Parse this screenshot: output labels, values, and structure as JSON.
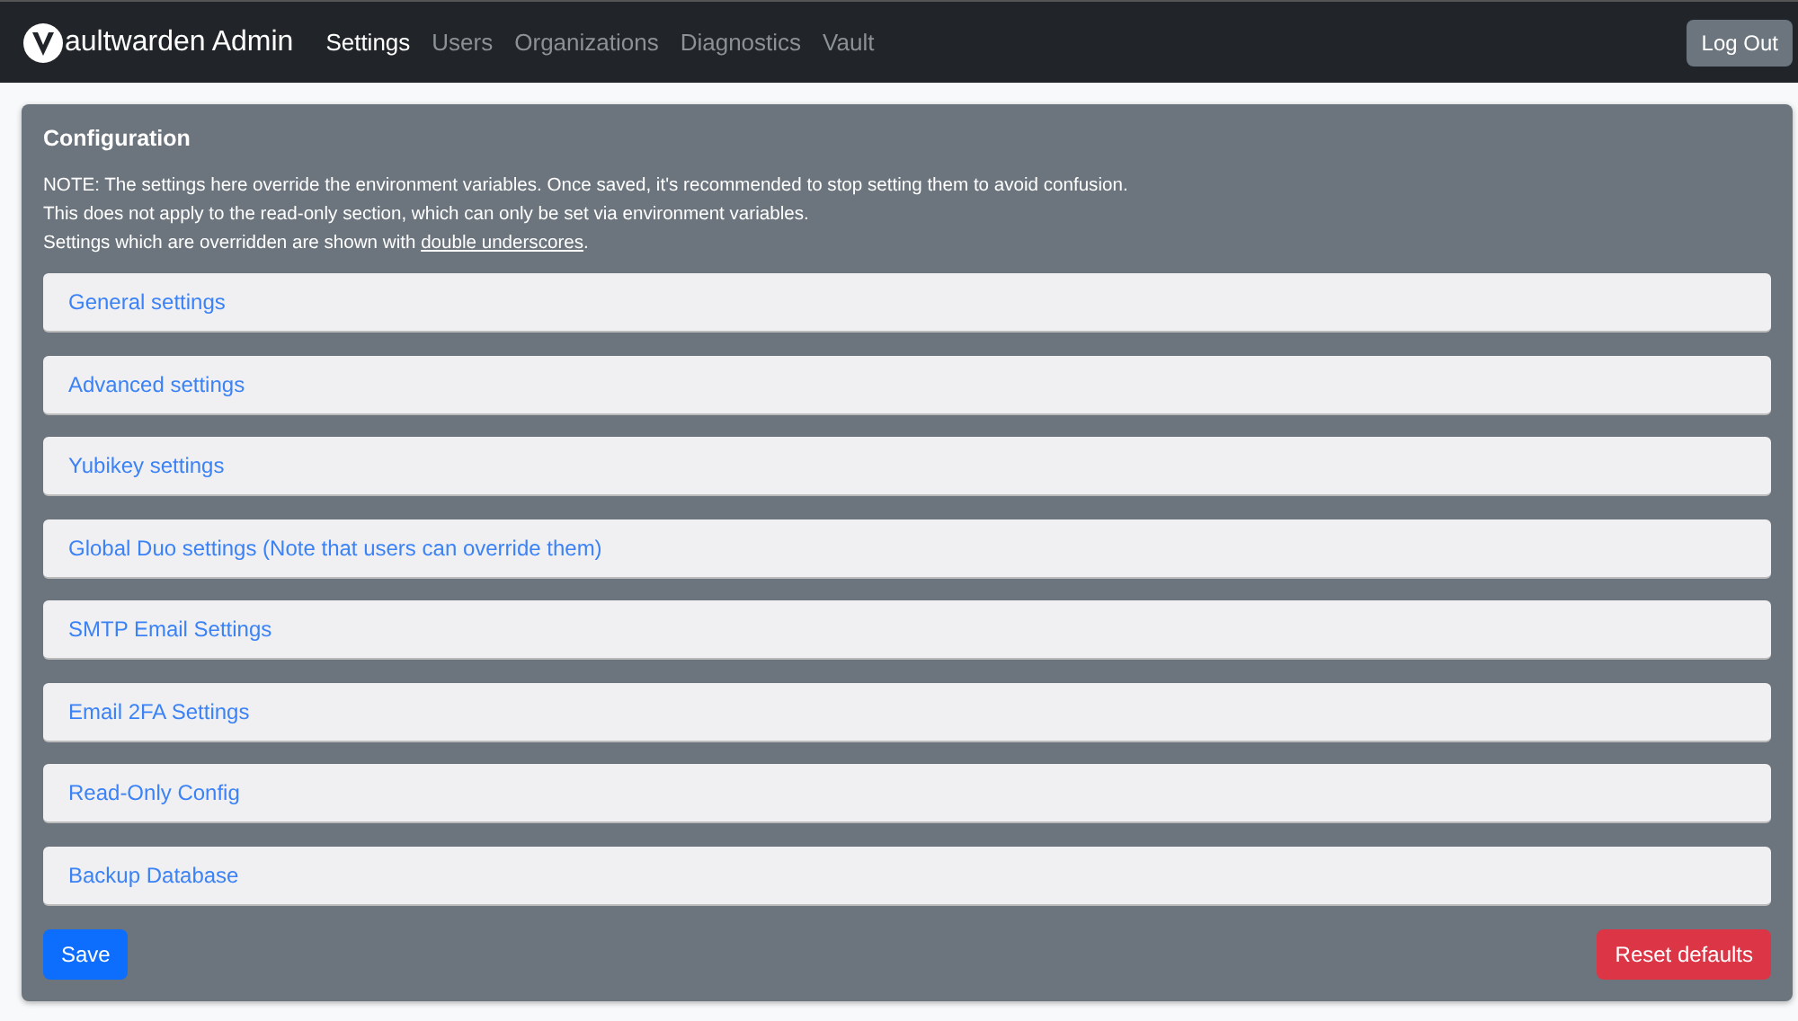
{
  "navbar": {
    "brand": "aultwarden Admin",
    "links": [
      {
        "label": "Settings",
        "selected": true
      },
      {
        "label": "Users",
        "selected": false
      },
      {
        "label": "Organizations",
        "selected": false
      },
      {
        "label": "Diagnostics",
        "selected": false
      },
      {
        "label": "Vault",
        "selected": false
      }
    ],
    "logout": "Log Out"
  },
  "panel": {
    "title": "Configuration",
    "note_lines": [
      "NOTE: The settings here override the environment variables. Once saved, it's recommended to stop setting them to avoid confusion.",
      "This does not apply to the read-only section, which can only be set via environment variables."
    ],
    "legend": {
      "before": "Settings which are overridden are shown with ",
      "underlined": "double underscores",
      "after": "."
    },
    "sections": [
      {
        "label": "General settings",
        "expanded": false
      },
      {
        "label": "Advanced settings",
        "expanded": false
      },
      {
        "label": "Yubikey settings",
        "expanded": false
      },
      {
        "label": "Global Duo settings (Note that users can override them)",
        "expanded": false
      },
      {
        "label": "SMTP Email Settings",
        "expanded": false
      },
      {
        "label": "Email 2FA Settings",
        "expanded": false
      },
      {
        "label": "Read-Only Config",
        "expanded": false
      },
      {
        "label": "Backup Database",
        "expanded": false
      }
    ],
    "save": "Save",
    "reset": "Reset defaults"
  }
}
